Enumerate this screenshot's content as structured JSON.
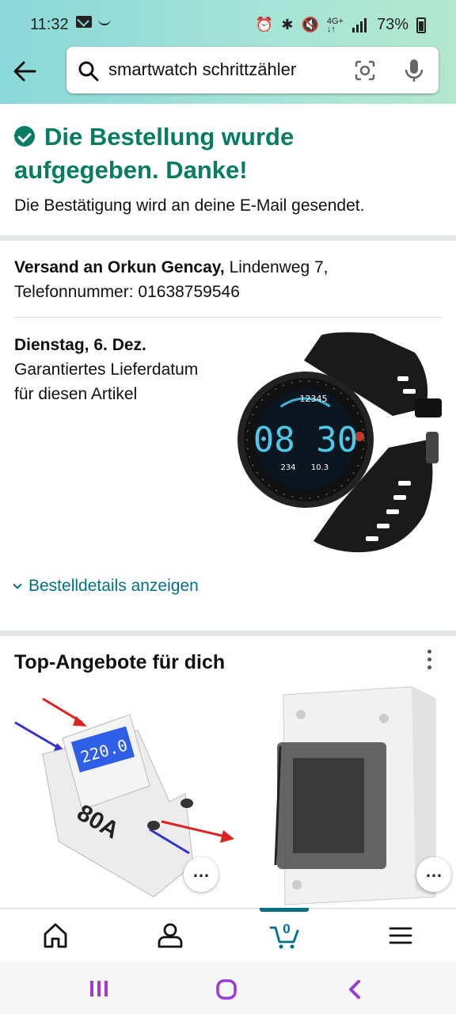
{
  "status_bar": {
    "time": "11:32",
    "battery": "73%",
    "icons": [
      "mail-icon",
      "smile-icon",
      "alarm-icon",
      "bluetooth-icon",
      "mute-icon",
      "4g-icon",
      "signal-icon",
      "battery-icon"
    ]
  },
  "search": {
    "query": "smartwatch schrittzähler",
    "icons": [
      "search-icon",
      "camera-icon",
      "mic-icon"
    ]
  },
  "confirmation": {
    "title": "Die Bestellung wurde aufgegeben. Danke!",
    "subtitle": "Die Bestätigung wird an deine E-Mail gesendet."
  },
  "shipping": {
    "label": "Versand an Orkun Gencay,",
    "address": " Lindenweg 7,",
    "phone": "Telefonnummer: 01638759546"
  },
  "delivery": {
    "date": "Dienstag, 6. Dez.",
    "note": "Garantiertes Lieferdatum für diesen Artikel"
  },
  "watch_display": {
    "time": "08 30",
    "steps": "12345",
    "left_stat": "234",
    "right_stat": "10.3"
  },
  "order_details_link": "Bestelldetails anzeigen",
  "offers": {
    "title": "Top-Angebote für dich",
    "product1_text": "80A",
    "product1_display": "220.0"
  },
  "nav": {
    "cart_count": "0",
    "items": [
      "home-icon",
      "account-icon",
      "cart-icon",
      "menu-icon"
    ]
  },
  "colors": {
    "accent_green": "#067d62",
    "link_teal": "#007185",
    "header_gradient_start": "#8ad8d9",
    "header_gradient_end": "#b4e8d0",
    "system_nav_purple": "#9b3ad6"
  }
}
